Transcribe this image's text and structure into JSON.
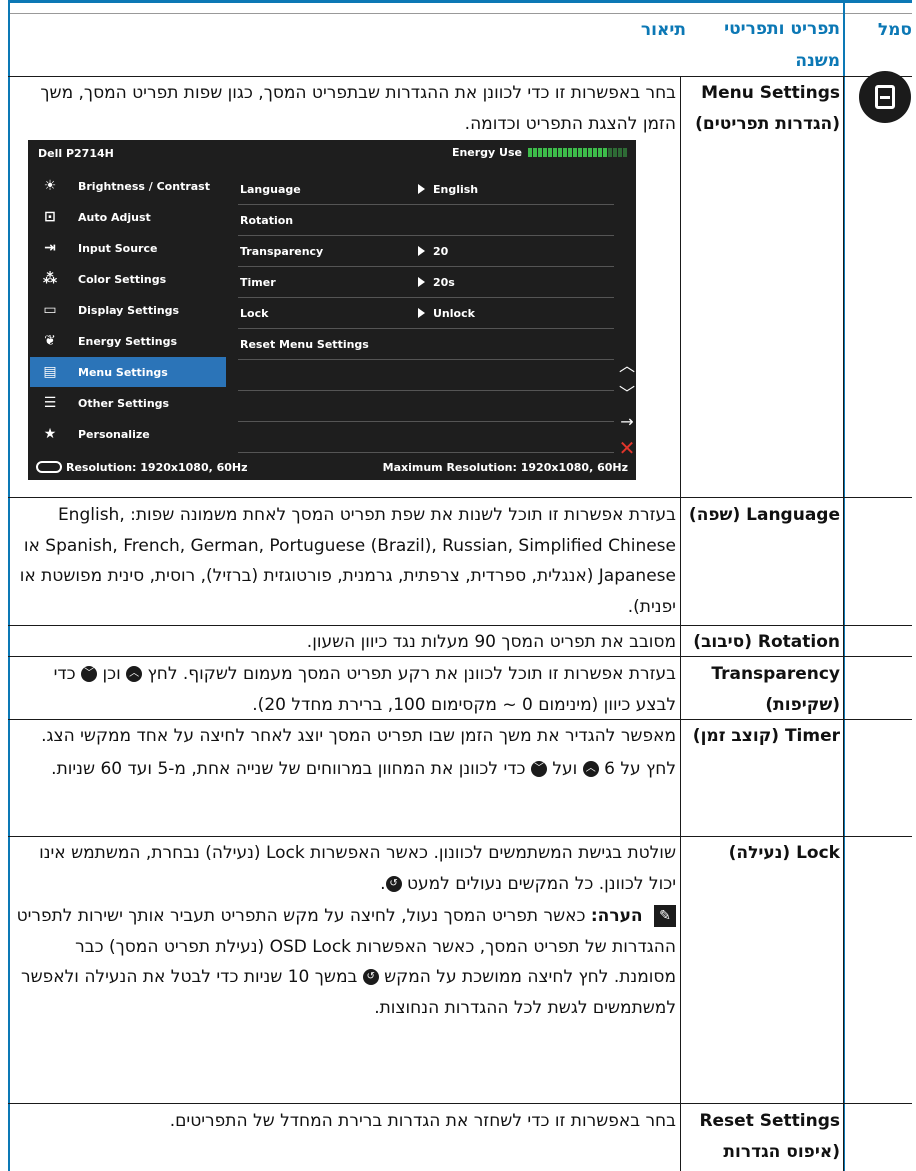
{
  "headers": {
    "symbol": "סמל",
    "option": "תפריט ותפריטי משנה",
    "description": "תיאור"
  },
  "menu_settings": {
    "name": "Menu Settings (הגדרות תפריטים)",
    "icon": "menu-settings-icon",
    "desc": "בחר באפשרות זו כדי לכוונן את ההגדרות שבתפריט המסך, כגון שפות תפריט המסך, משך הזמן להצגת התפריט וכדומה."
  },
  "osd": {
    "model": "Dell P2714H",
    "energy_label": "Energy Use",
    "energy_level": 0.8,
    "menu_items": [
      {
        "label": "Brightness / Contrast",
        "icon": "brightness-icon"
      },
      {
        "label": "Auto Adjust",
        "icon": "auto-adjust-icon"
      },
      {
        "label": "Input Source",
        "icon": "input-source-icon"
      },
      {
        "label": "Color Settings",
        "icon": "color-settings-icon"
      },
      {
        "label": "Display Settings",
        "icon": "display-settings-icon"
      },
      {
        "label": "Energy Settings",
        "icon": "energy-settings-icon"
      },
      {
        "label": "Menu Settings",
        "icon": "menu-settings-icon"
      },
      {
        "label": "Other Settings",
        "icon": "other-settings-icon"
      },
      {
        "label": "Personalize",
        "icon": "personalize-icon"
      }
    ],
    "active_index": 6,
    "sub_rows": [
      {
        "key": "Language",
        "value": "English"
      },
      {
        "key": "Rotation",
        "value": ""
      },
      {
        "key": "Transparency",
        "value": "20"
      },
      {
        "key": "Timer",
        "value": "20s"
      },
      {
        "key": "Lock",
        "value": "Unlock"
      },
      {
        "key": "Reset Menu Settings",
        "value": ""
      }
    ],
    "resolution": "Resolution: 1920x1080, 60Hz",
    "max_resolution": "Maximum Resolution: 1920x1080, 60Hz",
    "buttons": [
      "up-icon",
      "down-icon",
      "enter-icon",
      "exit-icon"
    ]
  },
  "rows": {
    "language": {
      "name": "Language (שפה)",
      "desc": "בעזרת אפשרות זו תוכל לשנות את שפת תפריט המסך לאחת משמונה שפות: English, Spanish, French, German, Portuguese (Brazil), Russian, Simplified Chinese או Japanese (אנגלית, ספרדית, צרפתית, גרמנית, פורטוגזית (ברזיל), רוסית, סינית מפושטת או יפנית)."
    },
    "rotation": {
      "name": "Rotation (סיבוב)",
      "desc": "מסובב את תפריט המסך 90 מעלות נגד כיוון השעון."
    },
    "transparency": {
      "name": "Transparency (שקיפות)",
      "desc_a": "בעזרת אפשרות זו תוכל לכוונן את רקע תפריט המסך מעמום לשקוף. לחץ",
      "desc_b": "וכן",
      "desc_c": "כדי לבצע כיוון (מינימום 0 ~ מקסימום 100, ברירת מחדל 20)."
    },
    "timer": {
      "name": "Timer (קוצב זמן)",
      "desc_1": "מאפשר להגדיר את משך הזמן שבו תפריט המסך יוצג לאחר לחיצה על אחד ממקשי הצג.",
      "desc_2a": "לחץ על",
      "desc_2b": "ועל",
      "desc_2c": "כדי לכוונן את המחוון במרווחים של שנייה אחת, מ-5 ועד 60 שניות."
    },
    "lock": {
      "name": "Lock (נעילה)",
      "desc_1": "שולטת בגישת המשתמשים לכוונון. כאשר האפשרות Lock (נעילה) נבחרת, המשתמש אינו יכול לכוונן. כל המקשים נעולים למעט",
      "note_label": "הערה:",
      "note_text_a": "כאשר תפריט המסך נעול, לחיצה על מקש התפריט תעביר אותך ישירות לתפריט ההגדרות של תפריט המסך, כאשר האפשרות OSD Lock (נעילת תפריט המסך) כבר מסומנת. לחץ לחיצה ממושכת על המקש",
      "note_text_b": "במשך 10 שניות כדי לבטל את הנעילה ולאפשר למשתמשים לגשת לכל ההגדרות הנחוצות."
    },
    "reset": {
      "name": "Reset Settings (איפוס הגדרות תפריטים)",
      "desc": "בחר באפשרות זו כדי לשחזר את הגדרות ברירת המחדל של התפריטים."
    }
  }
}
